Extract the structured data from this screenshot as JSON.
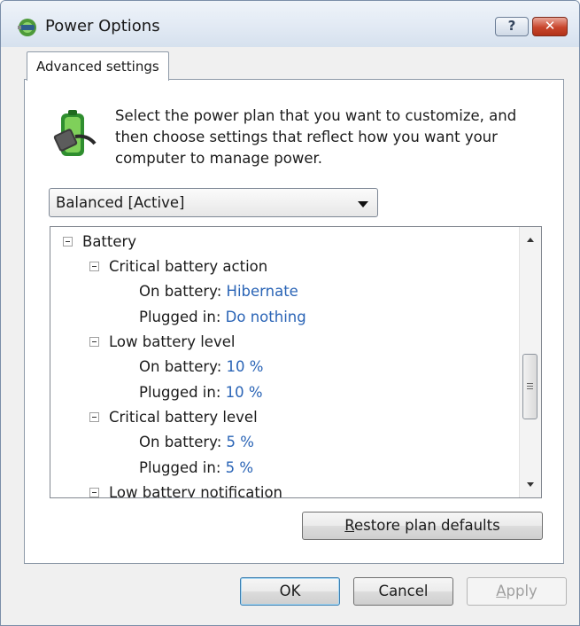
{
  "window": {
    "title": "Power Options",
    "help_label": "?",
    "close_label": "✕"
  },
  "tab": {
    "label": "Advanced settings"
  },
  "description": "Select the power plan that you want to customize, and then choose settings that reflect how you want your computer to manage power.",
  "plan_select": {
    "value": "Balanced [Active]"
  },
  "tree": {
    "battery": "Battery",
    "critical_action": {
      "label": "Critical battery action",
      "on_battery_label": "On battery:",
      "on_battery_value": "Hibernate",
      "plugged_in_label": "Plugged in:",
      "plugged_in_value": "Do nothing"
    },
    "low_level": {
      "label": "Low battery level",
      "on_battery_label": "On battery:",
      "on_battery_value": "10 %",
      "plugged_in_label": "Plugged in:",
      "plugged_in_value": "10 %"
    },
    "critical_level": {
      "label": "Critical battery level",
      "on_battery_label": "On battery:",
      "on_battery_value": "5 %",
      "plugged_in_label": "Plugged in:",
      "plugged_in_value": "5 %"
    },
    "low_notification": "Low battery notification"
  },
  "buttons": {
    "restore_first": "R",
    "restore_rest": "estore plan defaults",
    "ok": "OK",
    "cancel": "Cancel",
    "apply_first": "A",
    "apply_rest": "pply"
  },
  "colors": {
    "link_value": "#2a64b6",
    "close_red": "#c8452c",
    "titlebar": "#e2eaf4"
  }
}
